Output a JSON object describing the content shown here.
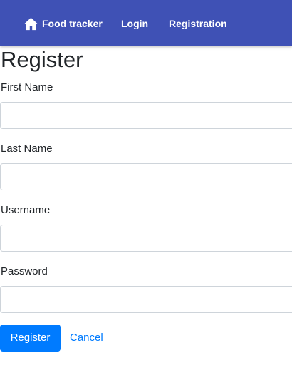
{
  "navbar": {
    "brand_label": "Food tracker",
    "brand_icon": "home-icon",
    "links": [
      {
        "label": "Login"
      },
      {
        "label": "Registration"
      }
    ],
    "color": "#3f51b5"
  },
  "page": {
    "title": "Register"
  },
  "form": {
    "fields": [
      {
        "label": "First Name",
        "value": ""
      },
      {
        "label": "Last Name",
        "value": ""
      },
      {
        "label": "Username",
        "value": ""
      },
      {
        "label": "Password",
        "value": ""
      }
    ],
    "submit_label": "Register",
    "cancel_label": "Cancel",
    "accent_color": "#007bff"
  }
}
